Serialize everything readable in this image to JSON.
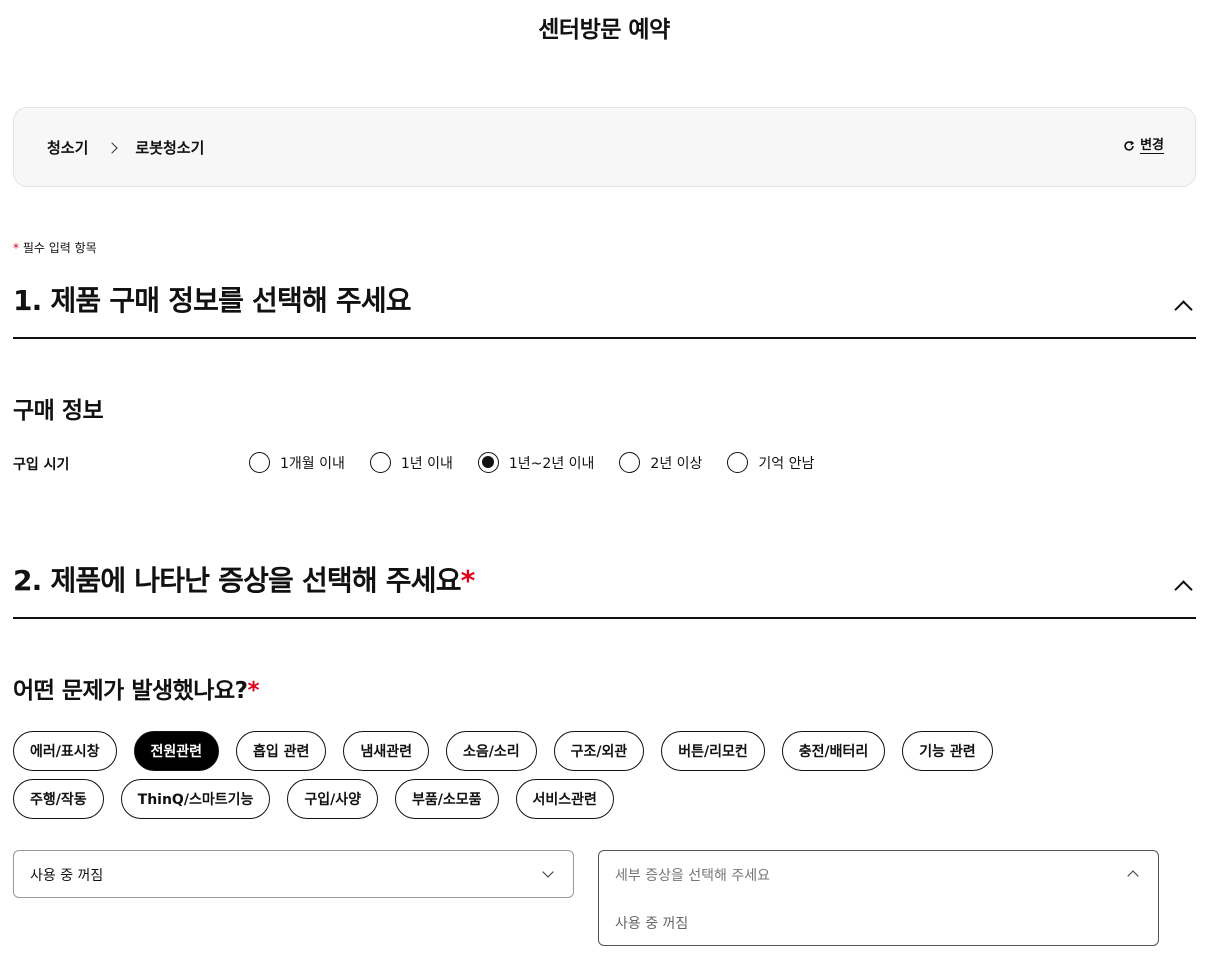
{
  "page": {
    "title": "센터방문 예약"
  },
  "breadcrumb": {
    "category": "청소기",
    "product": "로봇청소기",
    "change_label": "변경"
  },
  "required_note": {
    "star": "*",
    "text": " 필수 입력 항목"
  },
  "section1": {
    "title": "1. 제품 구매 정보를 선택해 주세요",
    "subtitle": "구매 정보",
    "purchase_label": "구입 시기",
    "options": [
      {
        "label": "1개월 이내",
        "checked": false
      },
      {
        "label": "1년 이내",
        "checked": false
      },
      {
        "label": "1년~2년 이내",
        "checked": true
      },
      {
        "label": "2년 이상",
        "checked": false
      },
      {
        "label": "기억 안남",
        "checked": false
      }
    ]
  },
  "section2": {
    "title": "2. 제품에 나타난 증상을 선택해 주세요",
    "star": "*",
    "question": "어떤 문제가 발생했나요?",
    "question_star": "*",
    "chips_row1": [
      "에러/표시창",
      "전원관련",
      "흡입 관련",
      "냄새관련",
      "소음/소리",
      "구조/외관",
      "버튼/리모컨",
      "충전/배터리",
      "기능 관련"
    ],
    "chips_row2": [
      "주행/작동",
      "ThinQ/스마트기능",
      "구입/사양",
      "부품/소모품",
      "서비스관련"
    ],
    "active_chip": "전원관련",
    "symptom_select": {
      "value": "사용 중 꺼짐"
    },
    "detail_select": {
      "placeholder": "세부 증상을 선택해 주세요",
      "options": [
        "사용 중 꺼짐"
      ]
    }
  },
  "colors": {
    "accent": "#e0001b",
    "active_chip_bg": "#000000",
    "panel_bg": "#f7f7f7"
  }
}
